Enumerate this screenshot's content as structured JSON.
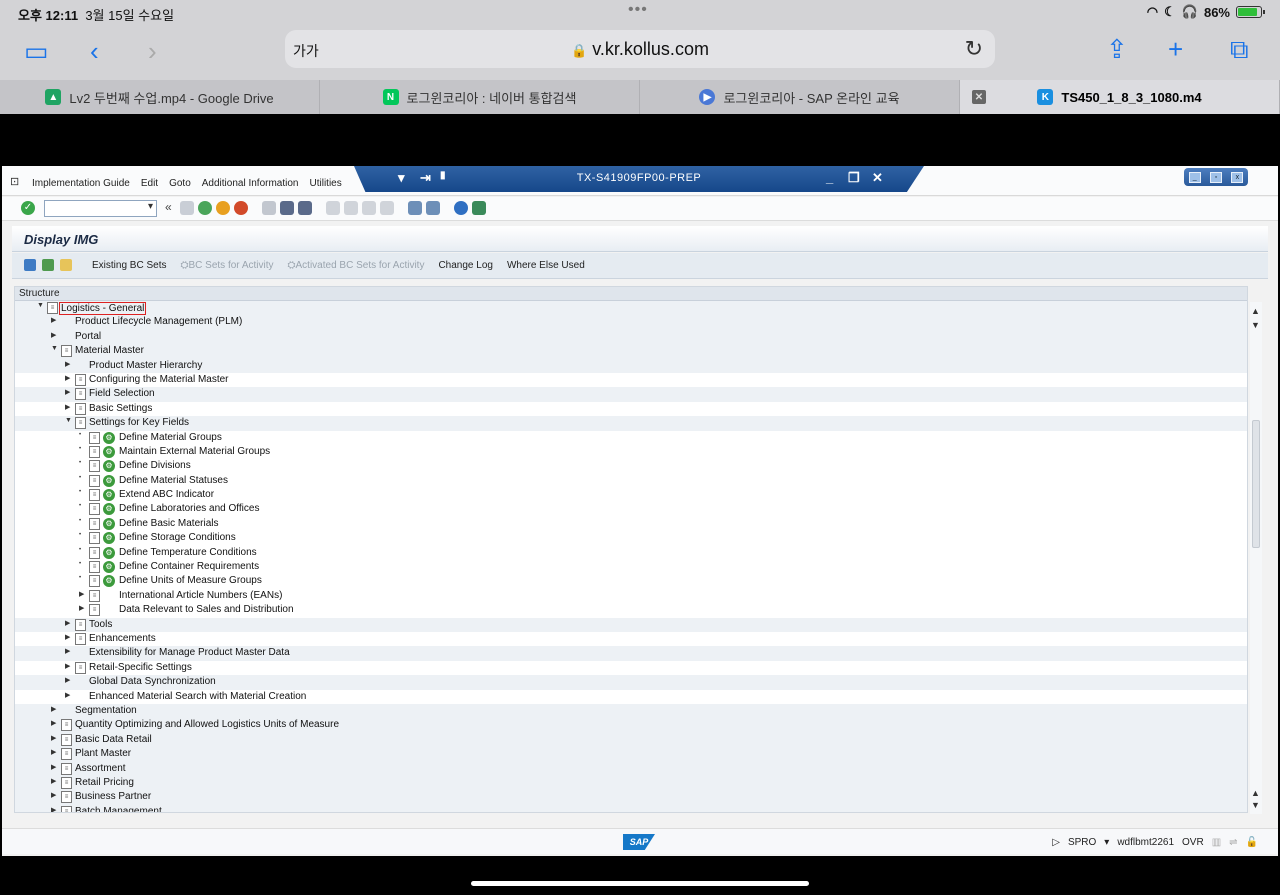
{
  "ios": {
    "time": "오후 12:11",
    "date": "3월 15일 수요일",
    "battery": "86%",
    "battery_level": 0.86
  },
  "safari": {
    "text_size_label": "가가",
    "url": "v.kr.kollus.com",
    "tabs": [
      {
        "label": "Lv2 두번째 수업.mp4 - Google Drive",
        "icon": "google-drive-icon",
        "color": "#1fa463"
      },
      {
        "label": "로그윈코리아 : 네이버 통합검색",
        "icon": "naver-icon",
        "color": "#03c75a"
      },
      {
        "label": "로그윈코리아 - SAP 온라인 교육",
        "icon": "play-icon",
        "color": "#4a78d6"
      },
      {
        "label": "TS450_1_8_3_1080.m4",
        "icon": "kollus-icon",
        "color": "#1a8fe0"
      }
    ]
  },
  "sap": {
    "menu": [
      "Implementation Guide",
      "Edit",
      "Goto",
      "Additional Information",
      "Utilities"
    ],
    "system_title": "TX-S41909FP00-PREP",
    "page_title": "Display IMG",
    "app_toolbar": [
      "Existing BC Sets",
      "BC Sets for Activity",
      "Activated BC Sets for Activity",
      "Change Log",
      "Where Else Used"
    ],
    "structure_header": "Structure",
    "tree": [
      {
        "label": "Logistics - General",
        "level": 0,
        "expand": "open",
        "doc": true,
        "exe": false,
        "selected": true
      },
      {
        "label": "Product Lifecycle Management (PLM)",
        "level": 1,
        "expand": "closed",
        "doc": false,
        "exe": false
      },
      {
        "label": "Portal",
        "level": 1,
        "expand": "closed",
        "doc": false,
        "exe": false
      },
      {
        "label": "Material Master",
        "level": 1,
        "expand": "open",
        "doc": true,
        "exe": false
      },
      {
        "label": "Product Master Hierarchy",
        "level": 2,
        "expand": "closed",
        "doc": false,
        "exe": false
      },
      {
        "label": "Configuring the Material Master",
        "level": 2,
        "expand": "closed",
        "doc": true,
        "exe": false
      },
      {
        "label": "Field Selection",
        "level": 2,
        "expand": "closed",
        "doc": true,
        "exe": false
      },
      {
        "label": "Basic Settings",
        "level": 2,
        "expand": "closed",
        "doc": true,
        "exe": false
      },
      {
        "label": "Settings for Key Fields",
        "level": 2,
        "expand": "open",
        "doc": true,
        "exe": false
      },
      {
        "label": "Define Material Groups",
        "level": 3,
        "expand": "leaf",
        "doc": true,
        "exe": true
      },
      {
        "label": "Maintain External Material Groups",
        "level": 3,
        "expand": "leaf",
        "doc": true,
        "exe": true
      },
      {
        "label": "Define Divisions",
        "level": 3,
        "expand": "leaf",
        "doc": true,
        "exe": true
      },
      {
        "label": "Define Material Statuses",
        "level": 3,
        "expand": "leaf",
        "doc": true,
        "exe": true
      },
      {
        "label": "Extend ABC Indicator",
        "level": 3,
        "expand": "leaf",
        "doc": true,
        "exe": true
      },
      {
        "label": "Define Laboratories and Offices",
        "level": 3,
        "expand": "leaf",
        "doc": true,
        "exe": true
      },
      {
        "label": "Define Basic Materials",
        "level": 3,
        "expand": "leaf",
        "doc": true,
        "exe": true
      },
      {
        "label": "Define Storage Conditions",
        "level": 3,
        "expand": "leaf",
        "doc": true,
        "exe": true
      },
      {
        "label": "Define Temperature Conditions",
        "level": 3,
        "expand": "leaf",
        "doc": true,
        "exe": true
      },
      {
        "label": "Define Container Requirements",
        "level": 3,
        "expand": "leaf",
        "doc": true,
        "exe": true
      },
      {
        "label": "Define Units of Measure Groups",
        "level": 3,
        "expand": "leaf",
        "doc": true,
        "exe": true
      },
      {
        "label": "International Article Numbers (EANs)",
        "level": 3,
        "expand": "closed",
        "doc": true,
        "exe": false
      },
      {
        "label": "Data Relevant to Sales and Distribution",
        "level": 3,
        "expand": "closed",
        "doc": true,
        "exe": false
      },
      {
        "label": "Tools",
        "level": 2,
        "expand": "closed",
        "doc": true,
        "exe": false
      },
      {
        "label": "Enhancements",
        "level": 2,
        "expand": "closed",
        "doc": true,
        "exe": false
      },
      {
        "label": "Extensibility for Manage Product Master Data",
        "level": 2,
        "expand": "closed",
        "doc": false,
        "exe": false
      },
      {
        "label": "Retail-Specific Settings",
        "level": 2,
        "expand": "closed",
        "doc": true,
        "exe": false
      },
      {
        "label": "Global Data Synchronization",
        "level": 2,
        "expand": "closed",
        "doc": false,
        "exe": false
      },
      {
        "label": "Enhanced Material Search with Material Creation",
        "level": 2,
        "expand": "closed",
        "doc": false,
        "exe": false
      },
      {
        "label": "Segmentation",
        "level": 1,
        "expand": "closed",
        "doc": false,
        "exe": false
      },
      {
        "label": "Quantity Optimizing and Allowed Logistics Units of Measure",
        "level": 1,
        "expand": "closed",
        "doc": true,
        "exe": false
      },
      {
        "label": "Basic Data Retail",
        "level": 1,
        "expand": "closed",
        "doc": true,
        "exe": false
      },
      {
        "label": "Plant Master",
        "level": 1,
        "expand": "closed",
        "doc": true,
        "exe": false
      },
      {
        "label": "Assortment",
        "level": 1,
        "expand": "closed",
        "doc": true,
        "exe": false
      },
      {
        "label": "Retail Pricing",
        "level": 1,
        "expand": "closed",
        "doc": true,
        "exe": false
      },
      {
        "label": "Business Partner",
        "level": 1,
        "expand": "closed",
        "doc": true,
        "exe": false
      },
      {
        "label": "Batch Management",
        "level": 1,
        "expand": "closed",
        "doc": true,
        "exe": false
      }
    ],
    "status": {
      "logo": "SAP",
      "transaction": "SPRO",
      "server": "wdflbmt2261",
      "mode": "OVR"
    }
  }
}
